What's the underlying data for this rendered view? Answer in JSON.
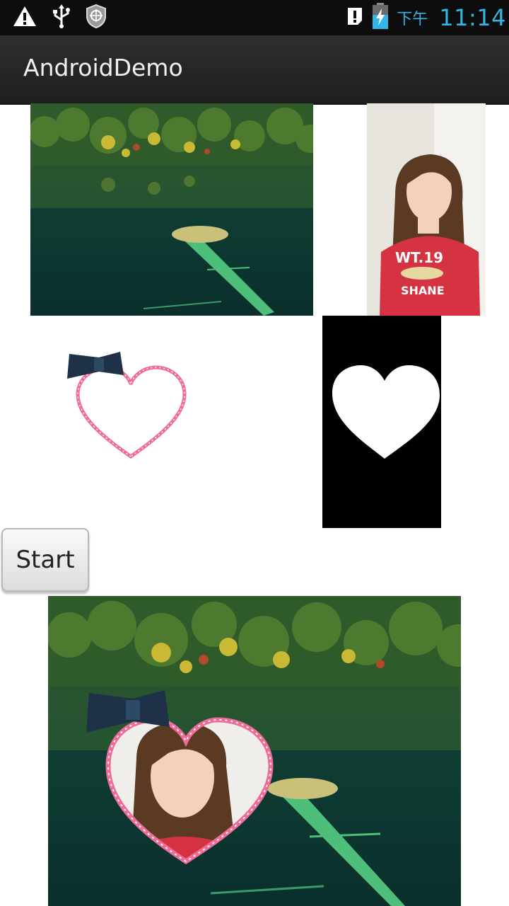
{
  "status_bar": {
    "icons_left": [
      "warning-icon",
      "usb-icon",
      "shield-icon"
    ],
    "icons_right": [
      "alert-icon",
      "battery-charging-icon"
    ],
    "ampm": "下午",
    "time": "11:14",
    "clock_color": "#33b5e5"
  },
  "action_bar": {
    "title": "AndroidDemo"
  },
  "images": {
    "lake_thumbnail": "lake-landscape-image",
    "girl_portrait": "girl-portrait-image",
    "heart_frame": "heart-frame-with-bow-image",
    "heart_mask": "heart-mask-image",
    "composite": "composite-heart-frame-image"
  },
  "start_button": {
    "label": "Start"
  }
}
